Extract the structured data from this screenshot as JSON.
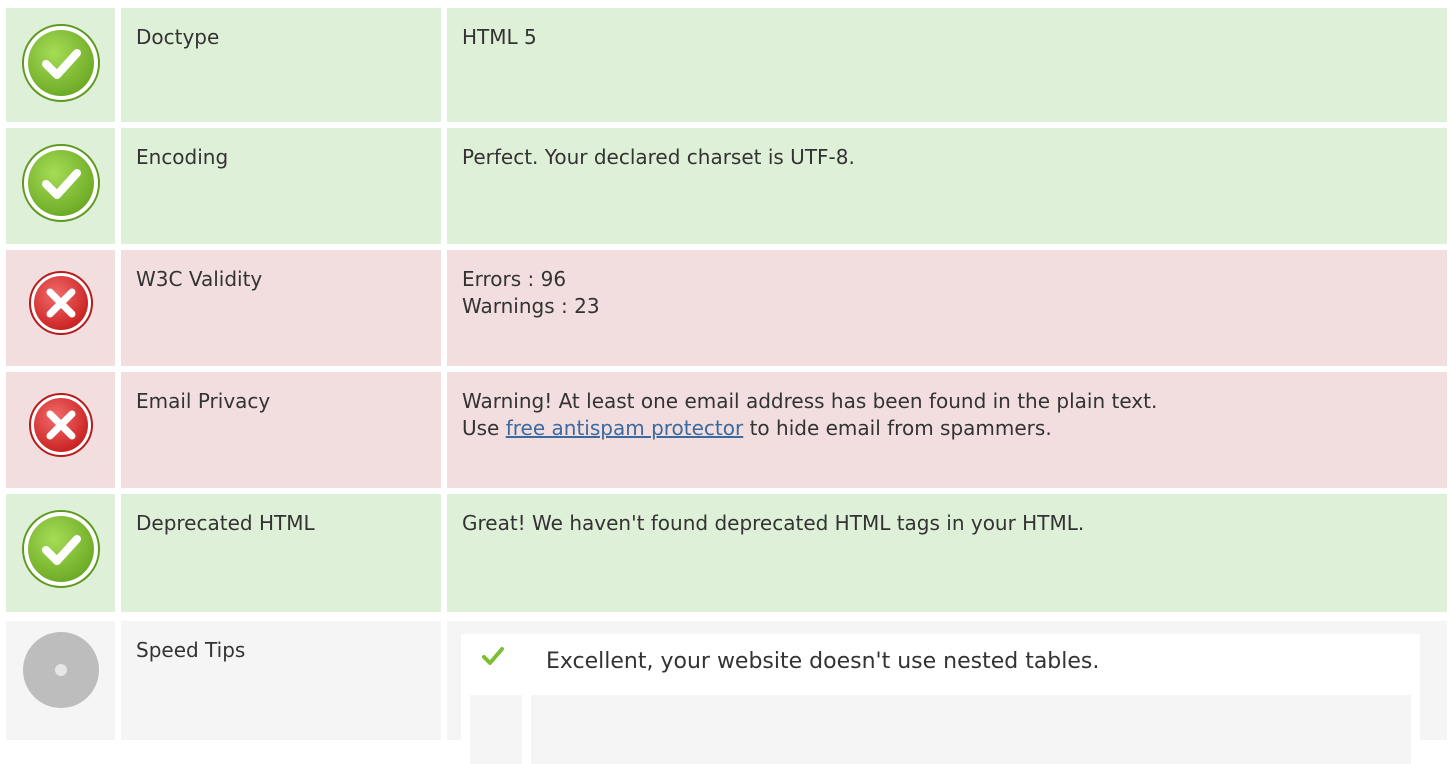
{
  "rows": [
    {
      "status": "pass",
      "icon": "check-circle-icon",
      "label": "Doctype",
      "value_lines": [
        "HTML 5"
      ]
    },
    {
      "status": "pass",
      "icon": "check-circle-icon",
      "label": "Encoding",
      "value_lines": [
        "Perfect. Your declared charset is UTF-8."
      ]
    },
    {
      "status": "fail",
      "icon": "error-circle-icon",
      "label": "W3C Validity",
      "value_lines": [
        "Errors : 96",
        "Warnings : 23"
      ]
    },
    {
      "status": "fail",
      "icon": "error-circle-icon",
      "label": "Email Privacy",
      "value_line1": "Warning! At least one email address has been found in the plain text.",
      "value_line2_prefix": "Use ",
      "value_line2_link": "free antispam protector",
      "value_line2_suffix": " to hide email from spammers."
    },
    {
      "status": "pass",
      "icon": "check-circle-icon",
      "label": "Deprecated HTML",
      "value_lines": [
        "Great! We haven't found deprecated HTML tags in your HTML."
      ]
    },
    {
      "status": "info",
      "icon": "neutral-circle-icon",
      "label": "Speed Tips",
      "tips": [
        {
          "icon": "checkmark-icon",
          "text": "Excellent, your website doesn't use nested tables."
        }
      ]
    }
  ],
  "colors": {
    "pass_bg": "#dff0d8",
    "fail_bg": "#f2dede",
    "info_bg": "#f5f5f5",
    "pass_icon": "#7cbf32",
    "fail_icon": "#e03a3a",
    "neutral_icon": "#bfbfbf",
    "link": "#3a6aa0"
  }
}
